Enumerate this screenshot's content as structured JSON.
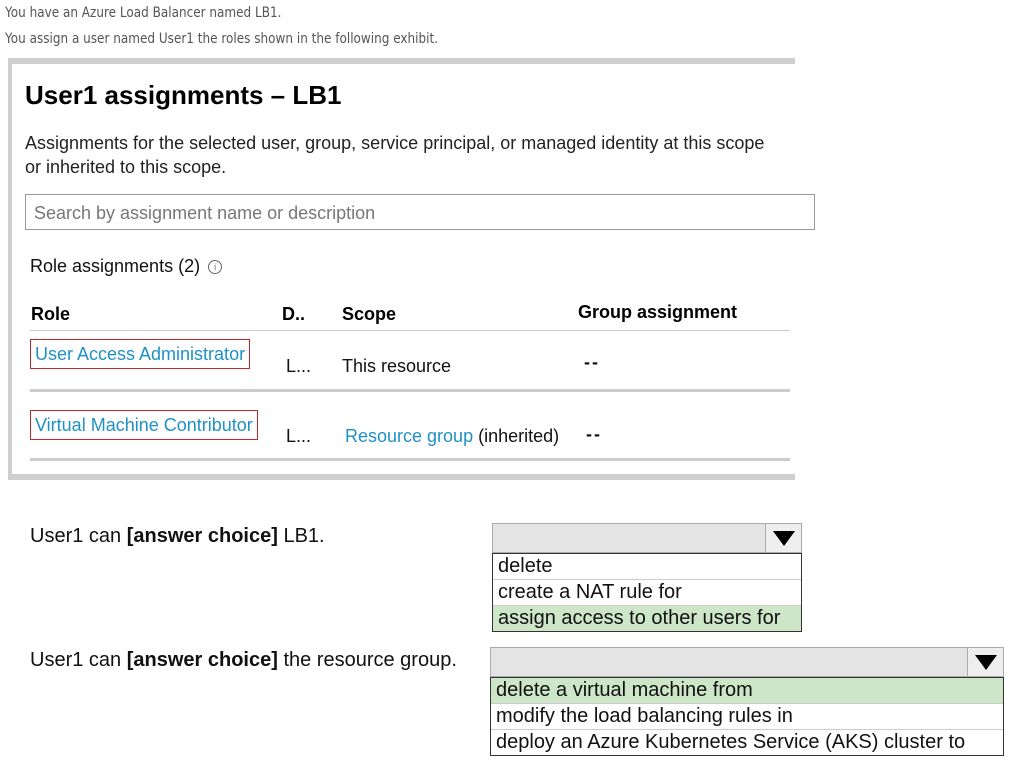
{
  "intro": {
    "line1": "You have an Azure Load Balancer named LB1.",
    "line2": "You assign a user named User1 the roles shown in the following exhibit."
  },
  "exhibit": {
    "title": "User1 assignments – LB1",
    "description": "Assignments for the selected user, group, service principal, or managed identity at this scope or inherited to this scope.",
    "search_placeholder": "Search by assignment name or description",
    "role_assignments_label": "Role assignments (2)",
    "info_icon": "ⓘ",
    "columns": {
      "role": "Role",
      "description": "D..",
      "scope": "Scope",
      "group": "Group assignment"
    },
    "rows": [
      {
        "role": "User Access Administrator",
        "description": "L...",
        "scope": "This resource",
        "scope_suffix": "",
        "group": "--"
      },
      {
        "role": "Virtual Machine Contributor",
        "description": "L...",
        "scope": "Resource group",
        "scope_suffix": "(inherited)",
        "group": "--"
      }
    ]
  },
  "questions": [
    {
      "prefix": "User1 can ",
      "bold": "[answer choice]",
      "suffix": " LB1.",
      "options": [
        "delete",
        "create a NAT rule for",
        "assign access to other users for"
      ],
      "selected_index": 2
    },
    {
      "prefix": "User1 can ",
      "bold": "[answer choice]",
      "suffix": " the resource group.",
      "options": [
        "delete a virtual machine from",
        "modify the load balancing rules in",
        "deploy an Azure Kubernetes Service (AKS) cluster to"
      ],
      "selected_index": 0
    }
  ],
  "colors": {
    "link": "#1e91c7",
    "highlight_box": "#c0272d",
    "selected_option": "#cde6c8"
  }
}
